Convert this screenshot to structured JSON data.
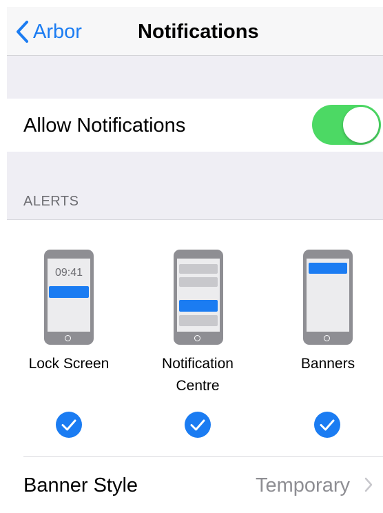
{
  "nav": {
    "back_label": "Arbor",
    "title": "Notifications"
  },
  "allow": {
    "label": "Allow Notifications",
    "enabled": true
  },
  "alerts": {
    "header": "ALERTS",
    "lock_screen_time": "09:41",
    "options": [
      {
        "label": "Lock Screen",
        "checked": true
      },
      {
        "label": "Notification",
        "label_line2": "Centre",
        "checked": true
      },
      {
        "label": "Banners",
        "checked": true
      }
    ]
  },
  "banner_style": {
    "label": "Banner Style",
    "value": "Temporary"
  },
  "colors": {
    "accent": "#1b7cf2",
    "toggle_on": "#4cd964",
    "group_bg": "#efeef4",
    "secondary_text": "#8e8e93"
  },
  "icons": {
    "back": "chevron-left-icon",
    "check": "checkmark-circle-icon",
    "disclosure": "chevron-right-icon"
  }
}
